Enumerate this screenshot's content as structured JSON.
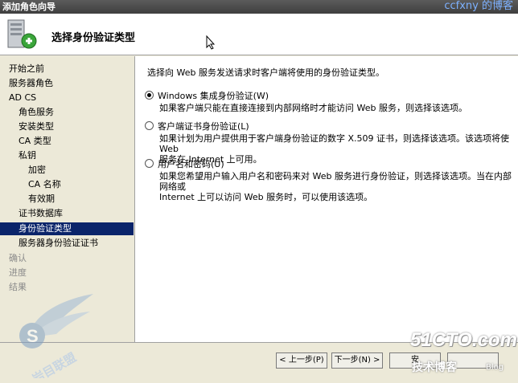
{
  "window": {
    "title": "添加角色向导",
    "watermark_top": "ccfxny 的博客"
  },
  "header": {
    "title": "选择身份验证类型",
    "icon": "server-add-icon"
  },
  "sidebar": {
    "items": [
      {
        "label": "开始之前",
        "state": "normal"
      },
      {
        "label": "服务器角色",
        "state": "normal"
      },
      {
        "label": "AD CS",
        "state": "normal"
      },
      {
        "label": "角色服务",
        "state": "normal"
      },
      {
        "label": "安装类型",
        "state": "normal"
      },
      {
        "label": "CA 类型",
        "state": "normal"
      },
      {
        "label": "私钥",
        "state": "normal"
      },
      {
        "label": "加密",
        "state": "normal"
      },
      {
        "label": "CA 名称",
        "state": "normal"
      },
      {
        "label": "有效期",
        "state": "normal"
      },
      {
        "label": "证书数据库",
        "state": "normal"
      },
      {
        "label": "身份验证类型",
        "state": "active"
      },
      {
        "label": "服务器身份验证证书",
        "state": "normal"
      },
      {
        "label": "确认",
        "state": "disabled"
      },
      {
        "label": "进度",
        "state": "disabled"
      },
      {
        "label": "结果",
        "state": "disabled"
      }
    ]
  },
  "content": {
    "intro": "选择向 Web 服务发送请求时客户端将使用的身份验证类型。",
    "options": [
      {
        "label": "Windows 集成身份验证(W)",
        "checked": true,
        "description": "如果客户端只能在直接连接到内部网络时才能访问 Web 服务，则选择该选项。"
      },
      {
        "label": "客户端证书身份验证(L)",
        "checked": false,
        "description": "如果计划为用户提供用于客户端身份验证的数字 X.509 证书，则选择该选项。该选项将使 Web\n服务在 Internet 上可用。"
      },
      {
        "label": "用户名和密码(U)",
        "checked": false,
        "description": "如果您希望用户输入用户名和密码来对 Web 服务进行身份验证，则选择该选项。当在内部网络或\nInternet 上可以访问 Web 服务时，可以使用该选项。"
      }
    ]
  },
  "footer": {
    "back_label": "< 上一步(P)",
    "next_label": "下一步(N) >",
    "install_label": "安",
    "cancel_label": ""
  },
  "watermarks": {
    "site": "51CTO.com",
    "blog_cn": "技术博客",
    "blog_en": "Blog",
    "logo_text": "岩目联盟"
  }
}
